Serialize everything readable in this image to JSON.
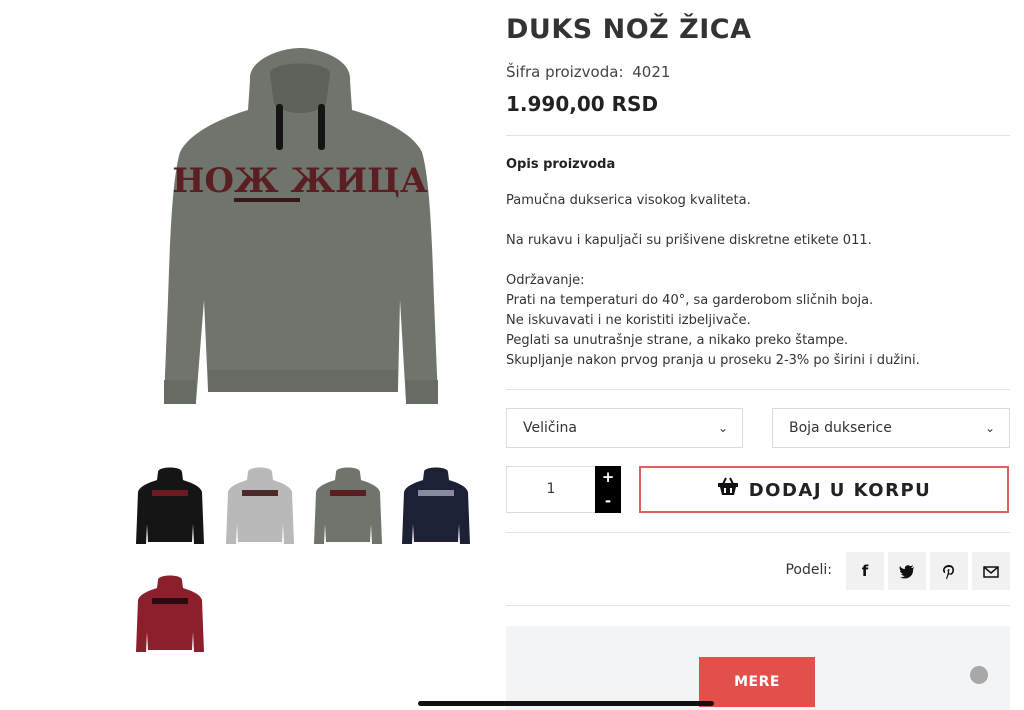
{
  "product": {
    "title": "DUKS NOŽ ŽICA",
    "sku_label": "Šifra proizvoda:",
    "sku_value": "4021",
    "price": "1.990,00 RSD",
    "print_text": "НОЖ ЖИЦА"
  },
  "description": {
    "heading": "Opis proizvoda",
    "lines": {
      "quality": "Pamučna dukserica visokog kvaliteta.",
      "labels": "Na rukavu i kapuljači su prišivene diskretne etikete 011.",
      "care_heading": "Održavanje:",
      "care_1": "Prati na temperaturi do 40°, sa garderobom sličnih boja.",
      "care_2": "Ne iskuvavati i ne koristiti izbeljivače.",
      "care_3": "Peglati sa unutrašnje strane, a nikako preko štampe.",
      "care_4": "Skupljanje nakon prvog pranja u proseku 2-3% po širini i dužini."
    }
  },
  "options": {
    "size_label": "Veličina",
    "color_label": "Boja dukserice"
  },
  "cart": {
    "quantity": "1",
    "plus": "+",
    "minus": "-",
    "add_label": "DODAJ U KORPU"
  },
  "share": {
    "label": "Podeli:",
    "facebook": "f"
  },
  "panel": {
    "mere_label": "MERE"
  },
  "thumbnails": [
    "black-hoodie",
    "gray-hoodie",
    "olive-hoodie",
    "navy-hoodie",
    "burgundy-hoodie"
  ],
  "colors": {
    "olive": "#6f756d",
    "black": "#151515",
    "gray": "#b9b9b9",
    "navy": "#1c2136",
    "burgundy": "#8c1f2c",
    "accent_red": "#e34f4b"
  }
}
